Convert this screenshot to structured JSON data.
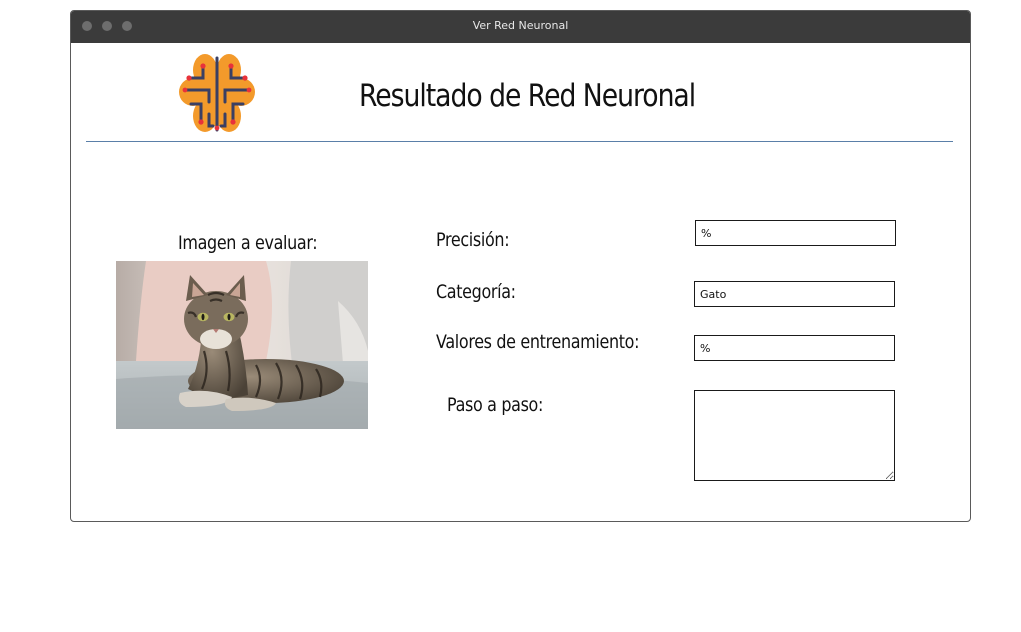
{
  "window": {
    "title": "Ver Red Neuronal"
  },
  "header": {
    "title": "Resultado de Red Neuronal",
    "logo_icon": "brain-circuit-icon"
  },
  "image_panel": {
    "label": "Imagen a evaluar:",
    "image_subject": "tabby cat lying on a sofa"
  },
  "results": {
    "precision": {
      "label": "Precisión:",
      "value": "%"
    },
    "category": {
      "label": "Categoría:",
      "value": "Gato"
    },
    "training": {
      "label": "Valores de entrenamiento:",
      "value": "%"
    },
    "steps": {
      "label": "Paso a paso:",
      "value": ""
    }
  },
  "colors": {
    "titlebar": "#3b3b3b",
    "divider": "#5a7fa8",
    "logo_orange": "#f39a2b",
    "logo_lines": "#3a3f63",
    "logo_nodes": "#e8323a"
  }
}
